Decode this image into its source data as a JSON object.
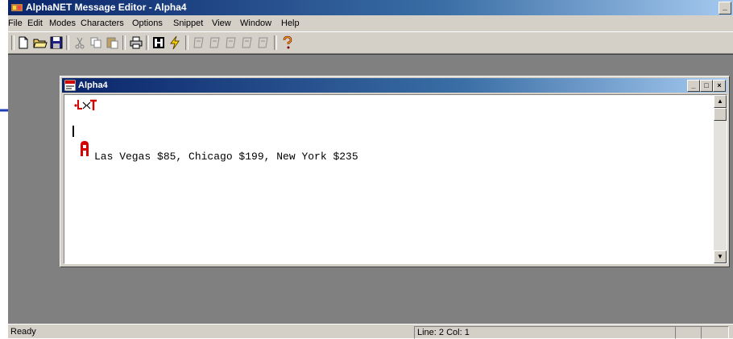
{
  "window": {
    "title": "AlphaNET Message Editor - Alpha4",
    "min_btn": "_"
  },
  "menu": [
    "File",
    "Edit",
    "Modes",
    "Characters",
    "Options",
    "Snippet",
    "View",
    "Window",
    "Help"
  ],
  "toolbar": {
    "buttons": [
      "new-doc-icon",
      "open-folder-icon",
      "save-disk-icon",
      "cut-icon",
      "copy-icon",
      "paste-icon",
      "print-icon",
      "send-icon",
      "lightning-icon",
      "snippet-1-icon",
      "snippet-2-icon",
      "snippet-3-icon",
      "snippet-4-icon",
      "snippet-5-icon",
      "help-icon"
    ]
  },
  "child_window": {
    "title": "Alpha4",
    "min_btn": "_",
    "max_btn": "□",
    "close_btn": "×"
  },
  "editor": {
    "control_code_icon": "mode-control-code-icon",
    "font_icon_letter": "A",
    "message_text": "Las Vegas $85, Chicago $199, New York $235"
  },
  "statusbar": {
    "ready": "Ready",
    "position": "Line: 2  Col: 1"
  },
  "colors": {
    "title_gradient_start": "#0a246a",
    "chrome": "#d4d0c8",
    "mdi_background": "#808080",
    "code_red": "#d40000",
    "arrow_blue": "#1f3fb8"
  }
}
